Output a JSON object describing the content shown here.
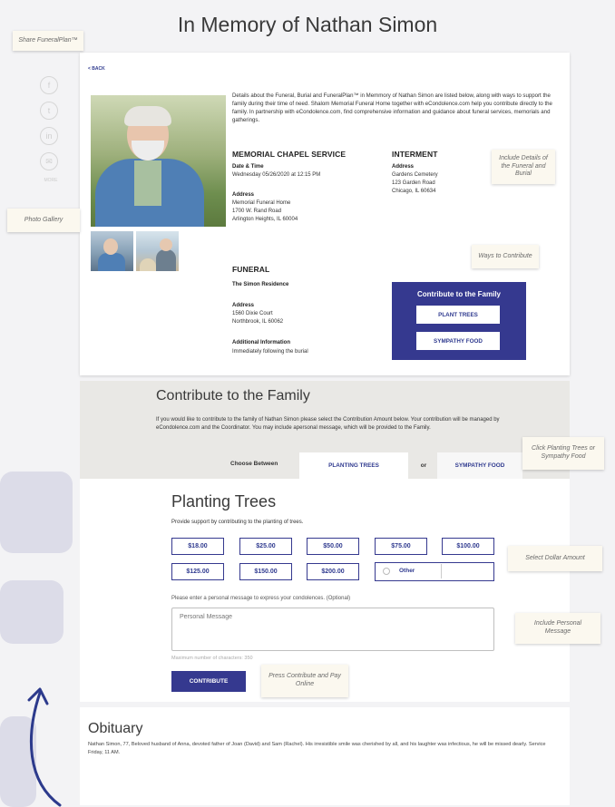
{
  "page": {
    "title": "In Memory of Nathan Simon",
    "back_label": "< BACK"
  },
  "callouts": {
    "share": "Share FuneralPlan™",
    "photo_gallery": "Photo Gallery",
    "details": "Include Details of the Funeral and Burial",
    "ways": "Ways to Contribute",
    "planting": "Click Planting Trees or Sympathy Food",
    "dollar": "Select Dollar Amount",
    "personal": "Include Personal Message",
    "press": "Press Contribute and Pay Online"
  },
  "social": {
    "icons": [
      "facebook-icon",
      "twitter-icon",
      "linkedin-icon",
      "email-icon"
    ],
    "glyphs": [
      "f",
      "t",
      "in",
      "✉"
    ],
    "more_label": "MORE"
  },
  "intro": "Details about the Funeral, Burial and FuneralPlan™ in Memmory of Nathan Simon are listed below, along with ways to support the family during their time of need. Shalom Memorial Funeral Home together with eCondolence.com help you contribute directly to the family. In partnership with eCondolence.com, find comprehensive information and guidance about funeral services, memorials and gatherings.",
  "chapel": {
    "title": "MEMORIAL CHAPEL SERVICE",
    "datetime_label": "Date & Time",
    "datetime_value": "Wednesday 05/26/2020 at 12:15 PM",
    "address_label": "Address",
    "address_lines": [
      "Memorial Funeral Home",
      "1700 W. Rand Road",
      "Arlington Heights, IL 60004"
    ]
  },
  "interment": {
    "title": "INTERMENT",
    "address_label": "Address",
    "address_lines": [
      "Gardens Cemetery",
      "123 Garden Road",
      "Chicago, IL 60634"
    ]
  },
  "funeral": {
    "title": "FUNERAL",
    "location": "The Simon Residence",
    "address_label": "Address",
    "address_lines": [
      "1560 Dixie Court",
      "Northbrook, IL 60062"
    ],
    "additional_label": "Additional Information",
    "additional_value": "Immediately following the burial"
  },
  "contribute_box": {
    "title": "Contribute to the Family",
    "plant_trees": "PLANT TREES",
    "sympathy_food": "SYMPATHY FOOD"
  },
  "contribute_section": {
    "title": "Contribute to the Family",
    "text": "If you would like to contribute to the family of Nathan Simon please select the Contribution Amount below. Your contribution will be managed by eCondolence.com and the Coordinator. You may include apersonal message, which will be provided to the Family.",
    "choose_label": "Choose Between",
    "tab_planting": "PLANTING TREES",
    "or_label": "or",
    "tab_sympathy": "SYMPATHY FOOD"
  },
  "planting": {
    "title": "Planting Trees",
    "subtitle": "Provide support by contributing to the planting of trees.",
    "amounts": [
      "$18.00",
      "$25.00",
      "$50.00",
      "$75.00",
      "$100.00",
      "$125.00",
      "$150.00",
      "$200.00"
    ],
    "other_label": "Other",
    "message_label": "Please enter a personal message to express your condolences. (Optional)",
    "message_placeholder": "Personal Message",
    "max_chars_label": "Maximum number of characters: 350",
    "contribute_label": "CONTRIBUTE"
  },
  "obituary": {
    "title": "Obituary",
    "text": "Nathan Simon, 77, Beloved husband of Anna, devoted father of Joan (David) and Sam (Rachel). His irresistible smile was cherished by all, and his laughter was infectious, he will be missed dearly. Service Friday, 11 AM."
  },
  "colors": {
    "brand": "#35398f",
    "callout_bg": "#fbf8ef",
    "band_bg": "#e9e8e5"
  }
}
